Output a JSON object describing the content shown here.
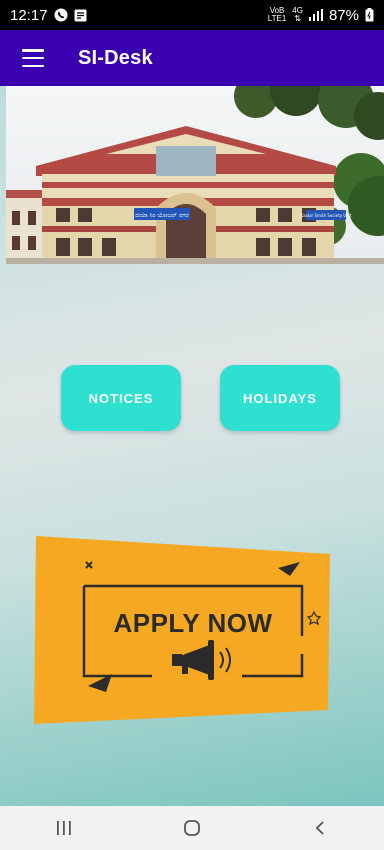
{
  "status": {
    "time": "12:17",
    "network_top": "VoB",
    "network_bottom": "LTE1",
    "signal_label": "4G",
    "battery": "87%"
  },
  "app_bar": {
    "title": "SI-Desk"
  },
  "banner": {
    "sign_left": "ದಯಾ ಸಿಂ ಯೋಜನ್ ನಗರ",
    "sign_right": "Kaalar Smith Society Unit"
  },
  "buttons": {
    "notices": "NOTICES",
    "holidays": "HOLIDAYS"
  },
  "apply_card": {
    "text": "APPLY NOW"
  },
  "colors": {
    "app_bar": "#3a00b0",
    "button": "#2ee0cf",
    "card": "#f7a823"
  }
}
